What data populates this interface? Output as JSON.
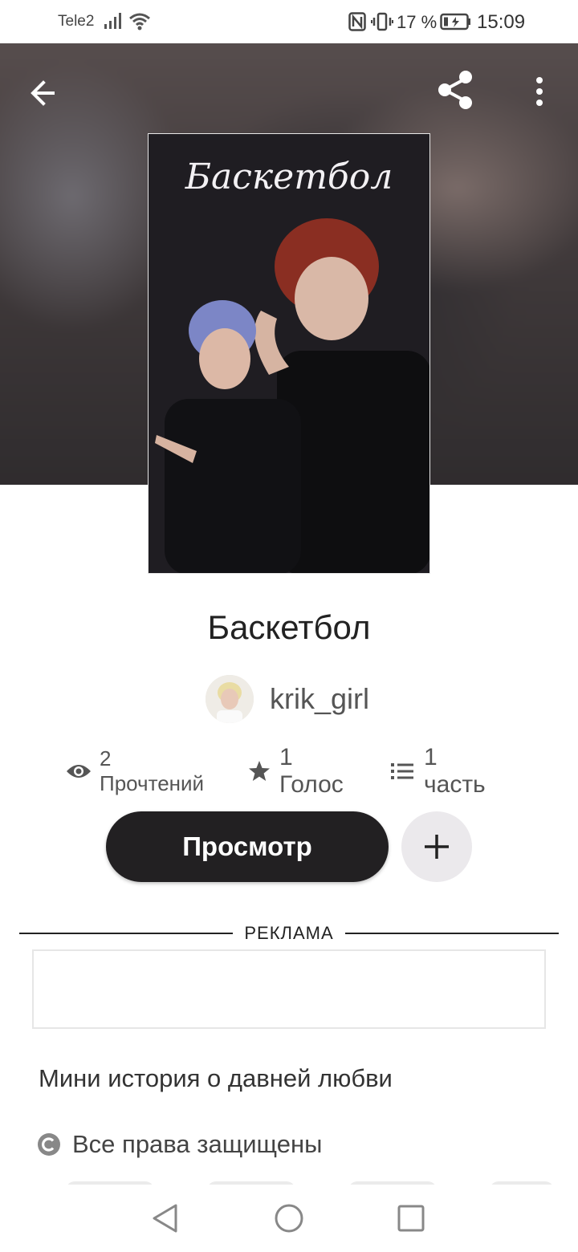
{
  "status_bar": {
    "carrier": "Tele2",
    "battery_percent": "17 %",
    "time": "15:09",
    "icons": [
      "signal-icon",
      "wifi-icon",
      "nfc-icon",
      "vibrate-icon",
      "battery-charging-icon"
    ]
  },
  "toolbar": {
    "back_icon": "arrow-left-icon",
    "share_icon": "share-icon",
    "more_icon": "more-vertical-icon"
  },
  "cover": {
    "title": "Баскетбол"
  },
  "story": {
    "title": "Баскетбол",
    "author": "krik_girl",
    "stats": {
      "reads": "2 Прочтений",
      "votes": "1 Голос",
      "parts": "1 часть"
    },
    "read_button_label": "Просмотр",
    "description": "Мини история о давней любви",
    "copyright": "Все права защищены"
  },
  "ad": {
    "label": "РЕКЛАМА"
  },
  "nav_bar": {
    "icons": [
      "nav-back-icon",
      "nav-home-icon",
      "nav-recent-icon"
    ]
  }
}
